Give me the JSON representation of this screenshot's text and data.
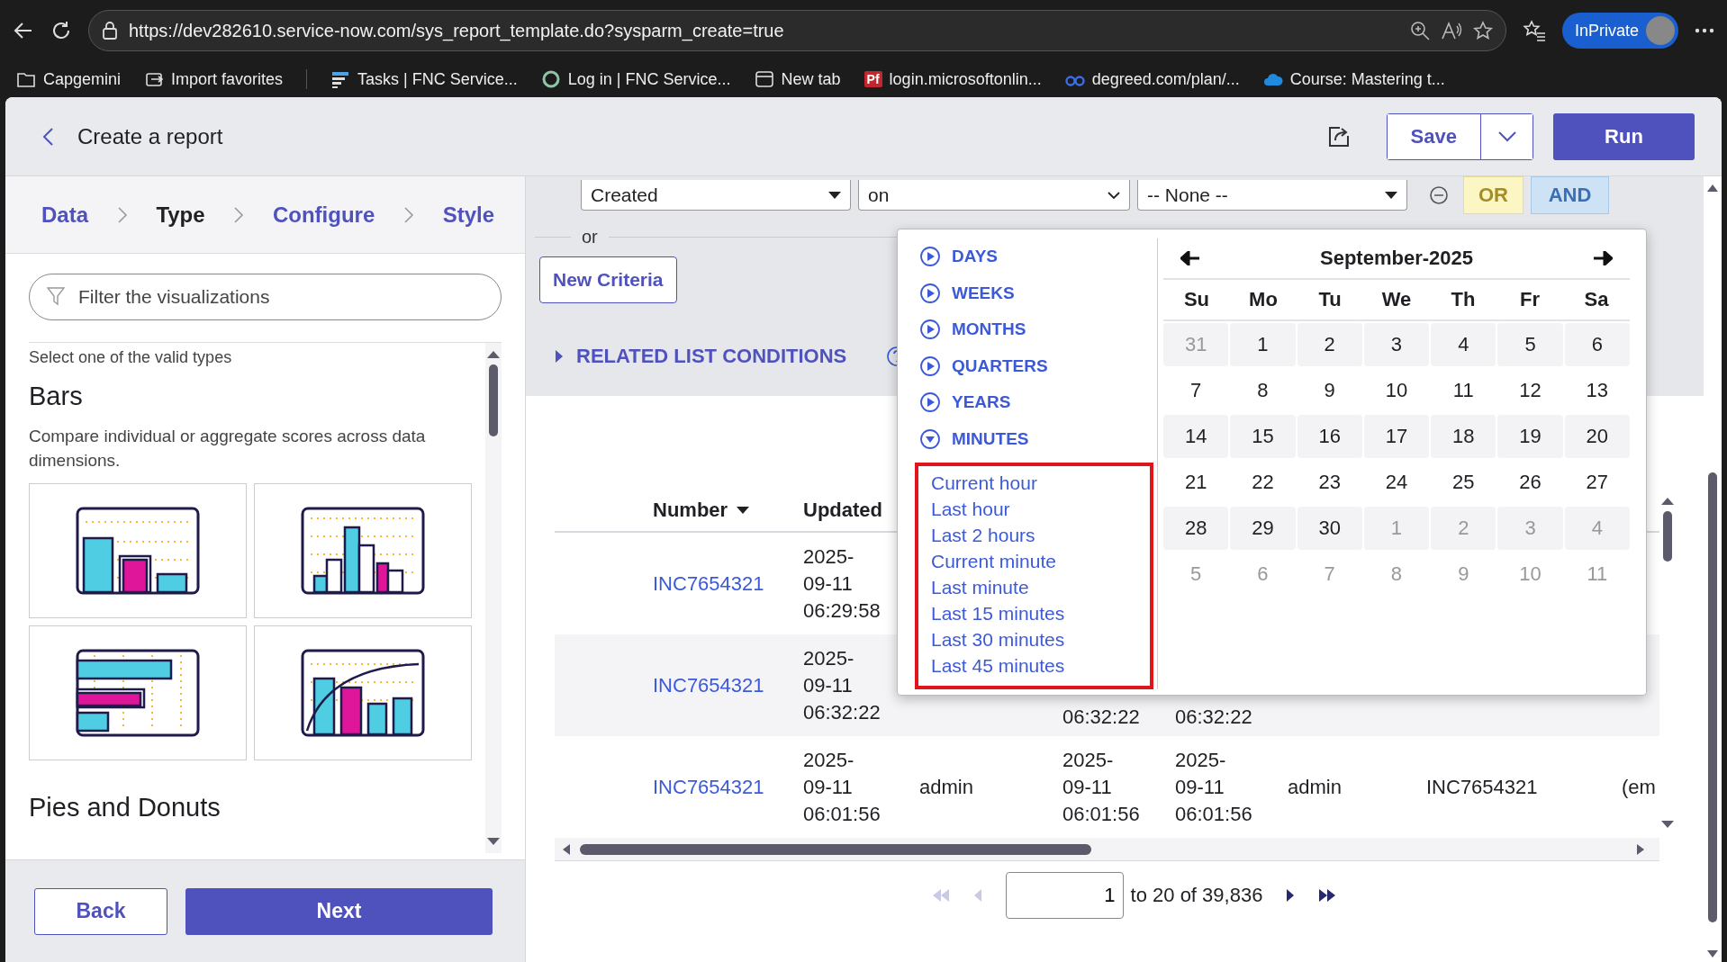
{
  "browser": {
    "url": "https://dev282610.service-now.com/sys_report_template.do?sysparm_create=true",
    "profile": "InPrivate"
  },
  "bookmarks": [
    {
      "label": "Capgemini",
      "kind": "folder"
    },
    {
      "label": "Import favorites",
      "kind": "import"
    },
    {
      "label": "Tasks | FNC Service...",
      "kind": "tasks"
    },
    {
      "label": "Log in | FNC Service...",
      "kind": "ring"
    },
    {
      "label": "New tab",
      "kind": "tab"
    },
    {
      "label": "login.microsoftonlin...",
      "kind": "badge",
      "badge": "Pf"
    },
    {
      "label": "degreed.com/plan/...",
      "kind": "glasses"
    },
    {
      "label": "Course: Mastering t...",
      "kind": "cloud"
    }
  ],
  "header": {
    "title": "Create a report",
    "save": "Save",
    "run": "Run"
  },
  "steps": [
    {
      "label": "Data",
      "selected": false
    },
    {
      "label": "Type",
      "selected": true
    },
    {
      "label": "Configure",
      "selected": false
    },
    {
      "label": "Style",
      "selected": false
    }
  ],
  "filter": {
    "placeholder": "Filter the visualizations"
  },
  "types": {
    "hint": "Select one of the valid types",
    "groups": [
      {
        "title": "Bars",
        "description": "Compare individual or aggregate scores across data dimensions.",
        "thumbnails": [
          {
            "kind": "columns"
          },
          {
            "kind": "histogram"
          },
          {
            "kind": "horizontal"
          },
          {
            "kind": "pareto"
          }
        ]
      },
      {
        "title": "Pies and Donuts"
      }
    ]
  },
  "footer": {
    "back": "Back",
    "next": "Next"
  },
  "condition": {
    "field": "Created",
    "operator": "on",
    "value": "-- None --",
    "or": "OR",
    "and": "AND"
  },
  "or_label": "or",
  "new_criteria": "New Criteria",
  "related": {
    "label": "RELATED LIST CONDITIONS",
    "expanded": false
  },
  "table": {
    "columns": [
      {
        "label": "Number",
        "sorted": true
      },
      {
        "label": "Updated",
        "sorted": false
      }
    ],
    "rows": [
      {
        "number": "INC7654321",
        "updated": "2025-\n09-11\n06:29:58"
      },
      {
        "number": "INC7654321",
        "updated": "2025-\n09-11\n06:32:22",
        "column_4": "06:32:22",
        "column_5": "06:32:22"
      },
      {
        "number": "INC7654321",
        "updated": "2025-\n09-11\n06:01:56",
        "column_3": "admin",
        "column_4": "2025-\n09-11\n06:01:56",
        "column_5": "2025-\n09-11\n06:01:56",
        "column_6": "admin",
        "column_7": "INC7654321",
        "column_8": "(em"
      }
    ]
  },
  "pagination": {
    "page": "1",
    "range": "to 20 of 39,836"
  },
  "date_picker": {
    "units": [
      {
        "label": "DAYS",
        "expanded": false
      },
      {
        "label": "WEEKS",
        "expanded": false
      },
      {
        "label": "MONTHS",
        "expanded": false
      },
      {
        "label": "QUARTERS",
        "expanded": false
      },
      {
        "label": "YEARS",
        "expanded": false
      },
      {
        "label": "MINUTES",
        "expanded": true
      }
    ],
    "presets": {
      "highlighted": true,
      "items": [
        "Current hour",
        "Last hour",
        "Last 2 hours",
        "Current minute",
        "Last minute",
        "Last 15 minutes",
        "Last 30 minutes",
        "Last 45 minutes"
      ]
    },
    "month": "September-2025",
    "weekdays": [
      "Su",
      "Mo",
      "Tu",
      "We",
      "Th",
      "Fr",
      "Sa"
    ],
    "weeks": [
      [
        {
          "day": "31",
          "muted": true
        },
        {
          "day": "1",
          "muted": false
        },
        {
          "day": "2",
          "muted": false
        },
        {
          "day": "3",
          "muted": false
        },
        {
          "day": "4",
          "muted": false
        },
        {
          "day": "5",
          "muted": false
        },
        {
          "day": "6",
          "muted": false
        }
      ],
      [
        {
          "day": "7",
          "muted": false
        },
        {
          "day": "8",
          "muted": false
        },
        {
          "day": "9",
          "muted": false
        },
        {
          "day": "10",
          "muted": false
        },
        {
          "day": "11",
          "muted": false
        },
        {
          "day": "12",
          "muted": false
        },
        {
          "day": "13",
          "muted": false
        }
      ],
      [
        {
          "day": "14",
          "muted": false
        },
        {
          "day": "15",
          "muted": false
        },
        {
          "day": "16",
          "muted": false
        },
        {
          "day": "17",
          "muted": false
        },
        {
          "day": "18",
          "muted": false
        },
        {
          "day": "19",
          "muted": false
        },
        {
          "day": "20",
          "muted": false
        }
      ],
      [
        {
          "day": "21",
          "muted": false
        },
        {
          "day": "22",
          "muted": false
        },
        {
          "day": "23",
          "muted": false
        },
        {
          "day": "24",
          "muted": false
        },
        {
          "day": "25",
          "muted": false
        },
        {
          "day": "26",
          "muted": false
        },
        {
          "day": "27",
          "muted": false
        }
      ],
      [
        {
          "day": "28",
          "muted": false
        },
        {
          "day": "29",
          "muted": false
        },
        {
          "day": "30",
          "muted": false
        },
        {
          "day": "1",
          "muted": true
        },
        {
          "day": "2",
          "muted": true
        },
        {
          "day": "3",
          "muted": true
        },
        {
          "day": "4",
          "muted": true
        }
      ],
      [
        {
          "day": "5",
          "muted": true
        },
        {
          "day": "6",
          "muted": true
        },
        {
          "day": "7",
          "muted": true
        },
        {
          "day": "8",
          "muted": true
        },
        {
          "day": "9",
          "muted": true
        },
        {
          "day": "10",
          "muted": true
        },
        {
          "day": "11",
          "muted": true
        }
      ]
    ]
  }
}
